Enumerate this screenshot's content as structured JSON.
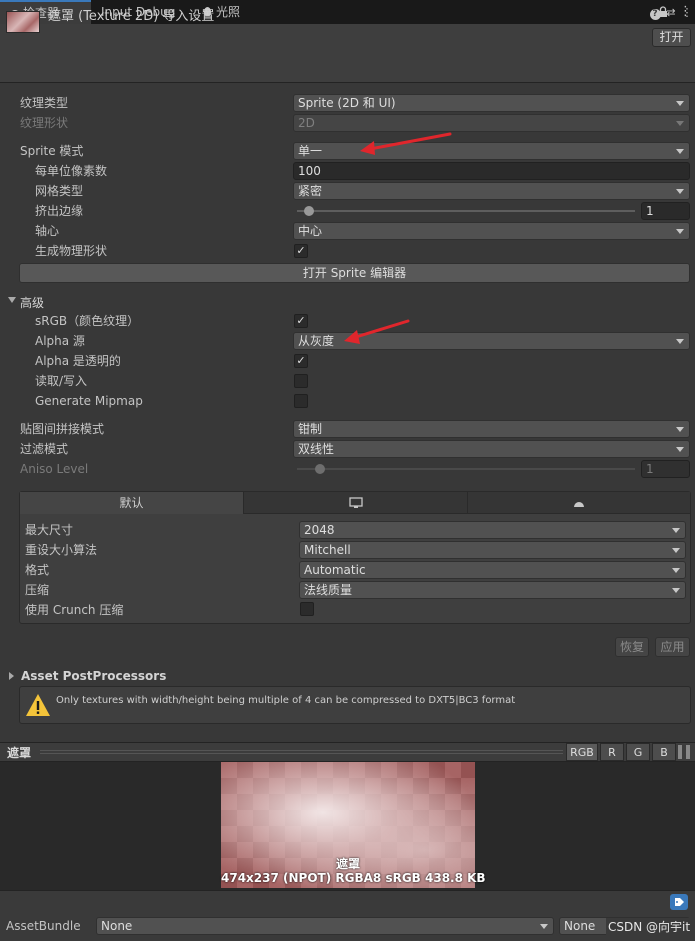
{
  "tabs": [
    {
      "label": "检查器",
      "icon": "info-icon"
    },
    {
      "label": "Input Debug"
    },
    {
      "label": "光照",
      "icon": "light-bulb-icon"
    }
  ],
  "header": {
    "title": "遮罩 (Texture 2D) 导入设置",
    "open_button": "打开"
  },
  "settings": {
    "texture_type_label": "纹理类型",
    "texture_type_value": "Sprite (2D 和 UI)",
    "texture_shape_label": "纹理形状",
    "texture_shape_value": "2D",
    "sprite_mode_label": "Sprite 模式",
    "sprite_mode_value": "单一",
    "ppu_label": "每单位像素数",
    "ppu_value": "100",
    "mesh_type_label": "网格类型",
    "mesh_type_value": "紧密",
    "extrude_label": "挤出边缘",
    "extrude_value": "1",
    "pivot_label": "轴心",
    "pivot_value": "中心",
    "physics_shape_label": "生成物理形状",
    "sprite_editor_button": "打开 Sprite 编辑器"
  },
  "advanced": {
    "header": "高级",
    "srgb_label": "sRGB（颜色纹理）",
    "alpha_source_label": "Alpha 源",
    "alpha_source_value": "从灰度",
    "alpha_transparent_label": "Alpha 是透明的",
    "read_write_label": "读取/写入",
    "mipmap_label": "Generate Mipmap"
  },
  "wrap": {
    "wrap_label": "贴图间拼接模式",
    "wrap_value": "钳制",
    "filter_label": "过滤模式",
    "filter_value": "双线性",
    "aniso_label": "Aniso Level",
    "aniso_value": "1"
  },
  "platform": {
    "tab_default": "默认",
    "max_size_label": "最大尺寸",
    "max_size_value": "2048",
    "resize_label": "重设大小算法",
    "resize_value": "Mitchell",
    "format_label": "格式",
    "format_value": "Automatic",
    "compression_label": "压缩",
    "compression_value": "法线质量",
    "crunch_label": "使用 Crunch 压缩"
  },
  "actions": {
    "revert": "恢复",
    "apply": "应用"
  },
  "postprocessors": {
    "header": "Asset PostProcessors",
    "warning": "Only textures with width/height being multiple of 4 can be compressed to DXT5|BC3 format"
  },
  "preview": {
    "title": "遮罩",
    "channels": [
      "RGB",
      "R",
      "G",
      "B"
    ],
    "caption_name": "遮罩",
    "caption_info": "474x237 (NPOT)  RGBA8 sRGB   438.8 KB"
  },
  "assetbundle": {
    "label": "AssetBundle",
    "name_value": "None",
    "variant_value": "None"
  },
  "watermark": "CSDN @向宇it",
  "colors": {
    "accent": "#3a79bb",
    "annotation_arrow": "#e0262c"
  }
}
